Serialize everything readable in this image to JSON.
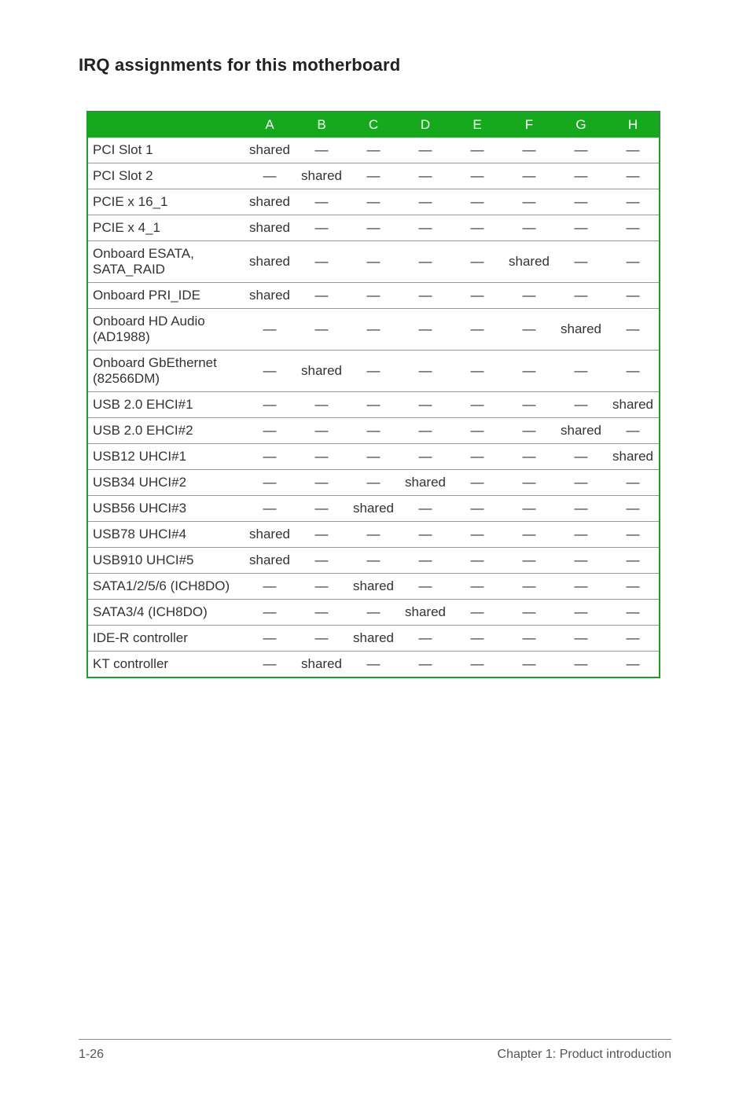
{
  "title": "IRQ assignments for this motherboard",
  "columns": [
    "A",
    "B",
    "C",
    "D",
    "E",
    "F",
    "G",
    "H"
  ],
  "rows": [
    {
      "label": "PCI Slot 1",
      "cells": [
        "shared",
        "—",
        "—",
        "—",
        "—",
        "—",
        "—",
        "—"
      ]
    },
    {
      "label": "PCI Slot 2",
      "cells": [
        "—",
        "shared",
        "—",
        "—",
        "—",
        "—",
        "—",
        "—"
      ]
    },
    {
      "label": "PCIE x 16_1",
      "cells": [
        "shared",
        "—",
        "—",
        "—",
        "—",
        "—",
        "—",
        "—"
      ]
    },
    {
      "label": "PCIE x 4_1",
      "cells": [
        "shared",
        "—",
        "—",
        "—",
        "—",
        "—",
        "—",
        "—"
      ]
    },
    {
      "label": "Onboard ESATA, SATA_RAID",
      "cells": [
        "shared",
        "—",
        "—",
        "—",
        "—",
        "shared",
        "—",
        "—"
      ]
    },
    {
      "label": "Onboard PRI_IDE",
      "cells": [
        "shared",
        "—",
        "—",
        "—",
        "—",
        "—",
        "—",
        "—"
      ]
    },
    {
      "label": "Onboard HD Audio (AD1988)",
      "cells": [
        "—",
        "—",
        "—",
        "—",
        "—",
        "—",
        "shared",
        "—"
      ]
    },
    {
      "label": "Onboard GbEthernet (82566DM)",
      "cells": [
        "—",
        "shared",
        "—",
        "—",
        "—",
        "—",
        "—",
        "—"
      ]
    },
    {
      "label": "USB 2.0 EHCI#1",
      "cells": [
        "—",
        "—",
        "—",
        "—",
        "—",
        "—",
        "—",
        "shared"
      ]
    },
    {
      "label": "USB 2.0 EHCI#2",
      "cells": [
        "—",
        "—",
        "—",
        "—",
        "—",
        "—",
        "shared",
        "—"
      ]
    },
    {
      "label": "USB12 UHCI#1",
      "cells": [
        "—",
        "—",
        "—",
        "—",
        "—",
        "—",
        "—",
        "shared"
      ]
    },
    {
      "label": "USB34 UHCI#2",
      "cells": [
        "—",
        "—",
        "—",
        "shared",
        "—",
        "—",
        "—",
        "—"
      ]
    },
    {
      "label": "USB56 UHCI#3",
      "cells": [
        "—",
        "—",
        "shared",
        "—",
        "—",
        "—",
        "—",
        "—"
      ]
    },
    {
      "label": "USB78 UHCI#4",
      "cells": [
        "shared",
        "—",
        "—",
        "—",
        "—",
        "—",
        "—",
        "—"
      ]
    },
    {
      "label": "USB910 UHCI#5",
      "cells": [
        "shared",
        "—",
        "—",
        "—",
        "—",
        "—",
        "—",
        "—"
      ]
    },
    {
      "label": "SATA1/2/5/6 (ICH8DO)",
      "cells": [
        "—",
        "—",
        "shared",
        "—",
        "—",
        "—",
        "—",
        "—"
      ]
    },
    {
      "label": "SATA3/4 (ICH8DO)",
      "cells": [
        "—",
        "—",
        "—",
        "shared",
        "—",
        "—",
        "—",
        "—"
      ]
    },
    {
      "label": "IDE-R controller",
      "cells": [
        "—",
        "—",
        "shared",
        "—",
        "—",
        "—",
        "—",
        "—"
      ]
    },
    {
      "label": "KT controller",
      "cells": [
        "—",
        "shared",
        "—",
        "—",
        "—",
        "—",
        "—",
        "—"
      ]
    }
  ],
  "footer": {
    "left": "1-26",
    "right": "Chapter 1: Product introduction"
  }
}
